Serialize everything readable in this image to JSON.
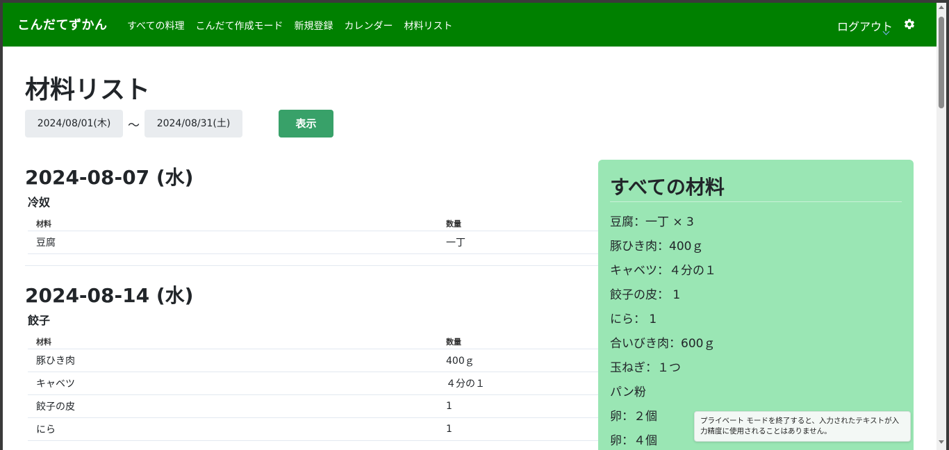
{
  "navbar": {
    "brand": "こんだてずかん",
    "items": [
      "すべての料理",
      "こんだて作成モード",
      "新規登録",
      "カレンダー",
      "材料リスト"
    ],
    "logout": "ログアウト",
    "settings_icon": "gear-icon",
    "color": "#008000"
  },
  "page": {
    "title": "材料リスト",
    "date_from": "2024/08/01(木)",
    "tilde": "〜",
    "date_to": "2024/08/31(土)",
    "show_button": "表示",
    "show_button_color": "#38a169"
  },
  "days": [
    {
      "date": "2024-08-07 (水)",
      "dish": "冷奴",
      "headers": [
        "材料",
        "数量"
      ],
      "rows": [
        [
          "豆腐",
          "一丁"
        ]
      ]
    },
    {
      "date": "2024-08-14 (水)",
      "dish": "餃子",
      "headers": [
        "材料",
        "数量"
      ],
      "rows": [
        [
          "豚ひき肉",
          "400ｇ"
        ],
        [
          "キャベツ",
          "４分の１"
        ],
        [
          "餃子の皮",
          "1"
        ],
        [
          "にら",
          "1"
        ]
      ]
    }
  ],
  "all_ingredients": {
    "title": "すべての材料",
    "items": [
      "豆腐：一丁 × 3",
      "豚ひき肉：400ｇ",
      "キャベツ：４分の１",
      "餃子の皮： 1",
      "にら： 1",
      "合いびき肉：600ｇ",
      "玉ねぎ：１つ",
      "パン粉",
      "卵：２個",
      "卵：４個"
    ],
    "panel_color": "#9ae6b4"
  },
  "toast": {
    "text": "プライベート モードを終了すると、入力されたテキストが入力精度に使用されることはありません。"
  }
}
